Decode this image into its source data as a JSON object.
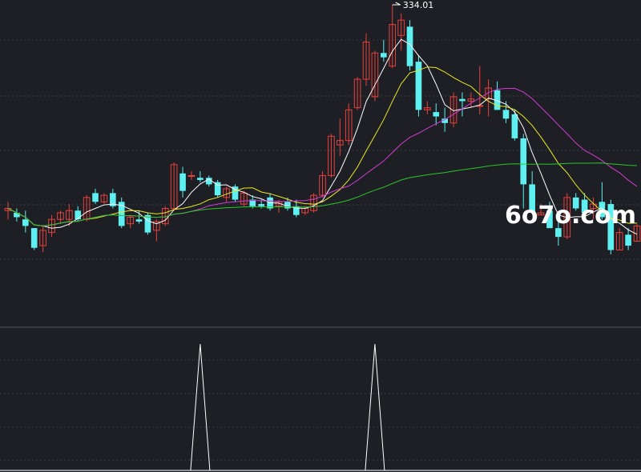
{
  "chart_data": {
    "type": "candlestick",
    "peak_label": "334.01",
    "up_color": "#e8413c",
    "down_color": "#5ef0f0",
    "ma_colors": {
      "ma5": "#ffffff",
      "ma10": "#e8e823",
      "ma20": "#d23cd2",
      "ma60": "#28c828"
    },
    "indicator_color": "#ffffff",
    "candles": [
      {
        "o": 240,
        "h": 244,
        "l": 236,
        "c": 241
      },
      {
        "o": 239,
        "h": 241,
        "l": 235,
        "c": 237
      },
      {
        "o": 236,
        "h": 240,
        "l": 230,
        "c": 233
      },
      {
        "o": 232,
        "h": 232,
        "l": 222,
        "c": 223
      },
      {
        "o": 224,
        "h": 233,
        "l": 221,
        "c": 231
      },
      {
        "o": 230,
        "h": 238,
        "l": 228,
        "c": 236
      },
      {
        "o": 236,
        "h": 240,
        "l": 234,
        "c": 239
      },
      {
        "o": 236,
        "h": 243,
        "l": 233,
        "c": 240
      },
      {
        "o": 240,
        "h": 242,
        "l": 235,
        "c": 236
      },
      {
        "o": 236,
        "h": 247,
        "l": 235,
        "c": 246
      },
      {
        "o": 248,
        "h": 250,
        "l": 243,
        "c": 244
      },
      {
        "o": 244,
        "h": 248,
        "l": 243,
        "c": 247
      },
      {
        "o": 248,
        "h": 250,
        "l": 241,
        "c": 242
      },
      {
        "o": 244,
        "h": 246,
        "l": 232,
        "c": 233
      },
      {
        "o": 234,
        "h": 238,
        "l": 232,
        "c": 237
      },
      {
        "o": 236,
        "h": 240,
        "l": 234,
        "c": 235
      },
      {
        "o": 238,
        "h": 239,
        "l": 229,
        "c": 230
      },
      {
        "o": 231,
        "h": 236,
        "l": 226,
        "c": 235
      },
      {
        "o": 234,
        "h": 242,
        "l": 233,
        "c": 241
      },
      {
        "o": 241,
        "h": 262,
        "l": 240,
        "c": 261
      },
      {
        "o": 257,
        "h": 260,
        "l": 246,
        "c": 249
      },
      {
        "o": 256,
        "h": 258,
        "l": 254,
        "c": 256
      },
      {
        "o": 255,
        "h": 258,
        "l": 253,
        "c": 254
      },
      {
        "o": 255,
        "h": 256,
        "l": 251,
        "c": 252
      },
      {
        "o": 253,
        "h": 254,
        "l": 246,
        "c": 247
      },
      {
        "o": 246,
        "h": 251,
        "l": 244,
        "c": 250
      },
      {
        "o": 251,
        "h": 252,
        "l": 244,
        "c": 245
      },
      {
        "o": 243,
        "h": 249,
        "l": 242,
        "c": 248
      },
      {
        "o": 245,
        "h": 247,
        "l": 241,
        "c": 242
      },
      {
        "o": 243,
        "h": 245,
        "l": 241,
        "c": 242
      },
      {
        "o": 246,
        "h": 248,
        "l": 240,
        "c": 241
      },
      {
        "o": 242,
        "h": 245,
        "l": 239,
        "c": 244
      },
      {
        "o": 244,
        "h": 246,
        "l": 240,
        "c": 241
      },
      {
        "o": 242,
        "h": 245,
        "l": 237,
        "c": 238
      },
      {
        "o": 239,
        "h": 242,
        "l": 238,
        "c": 241
      },
      {
        "o": 240,
        "h": 248,
        "l": 239,
        "c": 247
      },
      {
        "o": 247,
        "h": 258,
        "l": 246,
        "c": 256
      },
      {
        "o": 256,
        "h": 275,
        "l": 255,
        "c": 274
      },
      {
        "o": 270,
        "h": 282,
        "l": 265,
        "c": 272
      },
      {
        "o": 272,
        "h": 289,
        "l": 270,
        "c": 286
      },
      {
        "o": 287,
        "h": 301,
        "l": 286,
        "c": 300
      },
      {
        "o": 300,
        "h": 321,
        "l": 297,
        "c": 317
      },
      {
        "o": 292,
        "h": 313,
        "l": 290,
        "c": 312
      },
      {
        "o": 312,
        "h": 318,
        "l": 308,
        "c": 310
      },
      {
        "o": 306,
        "h": 334,
        "l": 305,
        "c": 325
      },
      {
        "o": 320,
        "h": 330,
        "l": 313,
        "c": 327
      },
      {
        "o": 324,
        "h": 327,
        "l": 304,
        "c": 306
      },
      {
        "o": 308,
        "h": 311,
        "l": 283,
        "c": 286
      },
      {
        "o": 286,
        "h": 290,
        "l": 284,
        "c": 287
      },
      {
        "o": 285,
        "h": 289,
        "l": 279,
        "c": 283
      },
      {
        "o": 282,
        "h": 287,
        "l": 276,
        "c": 280
      },
      {
        "o": 280,
        "h": 294,
        "l": 278,
        "c": 292
      },
      {
        "o": 291,
        "h": 294,
        "l": 283,
        "c": 290
      },
      {
        "o": 290,
        "h": 294,
        "l": 287,
        "c": 291
      },
      {
        "o": 288,
        "h": 306,
        "l": 284,
        "c": 288
      },
      {
        "o": 291,
        "h": 300,
        "l": 283,
        "c": 296
      },
      {
        "o": 295,
        "h": 299,
        "l": 286,
        "c": 286
      },
      {
        "o": 286,
        "h": 290,
        "l": 280,
        "c": 282
      },
      {
        "o": 284,
        "h": 286,
        "l": 272,
        "c": 273
      },
      {
        "o": 273,
        "h": 275,
        "l": 241,
        "c": 252
      },
      {
        "o": 252,
        "h": 258,
        "l": 240,
        "c": 239
      },
      {
        "o": 238,
        "h": 243,
        "l": 238,
        "c": 239
      },
      {
        "o": 240,
        "h": 244,
        "l": 232,
        "c": 232
      },
      {
        "o": 232,
        "h": 236,
        "l": 224,
        "c": 228
      },
      {
        "o": 228,
        "h": 248,
        "l": 227,
        "c": 246
      },
      {
        "o": 246,
        "h": 248,
        "l": 240,
        "c": 241
      },
      {
        "o": 245,
        "h": 248,
        "l": 236,
        "c": 239
      },
      {
        "o": 241,
        "h": 246,
        "l": 236,
        "c": 243
      },
      {
        "o": 244,
        "h": 253,
        "l": 236,
        "c": 237
      },
      {
        "o": 243,
        "h": 245,
        "l": 220,
        "c": 222
      },
      {
        "o": 222,
        "h": 232,
        "l": 222,
        "c": 230
      },
      {
        "o": 229,
        "h": 232,
        "l": 222,
        "c": 224
      },
      {
        "o": 226,
        "h": 234,
        "l": 226,
        "c": 233
      }
    ],
    "indicator": {
      "baseline": 0,
      "ymax": 10,
      "values": [
        0,
        0,
        0,
        0,
        0,
        0,
        0,
        0,
        0,
        0,
        0,
        0,
        0,
        0,
        0,
        0,
        0,
        0,
        0,
        0,
        0,
        0,
        10,
        0,
        0,
        0,
        0,
        0,
        0,
        0,
        0,
        0,
        0,
        0,
        0,
        0,
        0,
        0,
        0,
        0,
        0,
        0,
        10,
        0,
        0,
        0,
        0,
        0,
        0,
        0,
        0,
        0,
        0,
        0,
        0,
        0,
        0,
        0,
        0,
        0,
        0,
        0,
        0,
        0,
        0,
        0,
        0,
        0,
        0,
        0,
        0,
        0,
        0,
        0,
        0
      ]
    }
  },
  "watermark": "6o7o.com"
}
